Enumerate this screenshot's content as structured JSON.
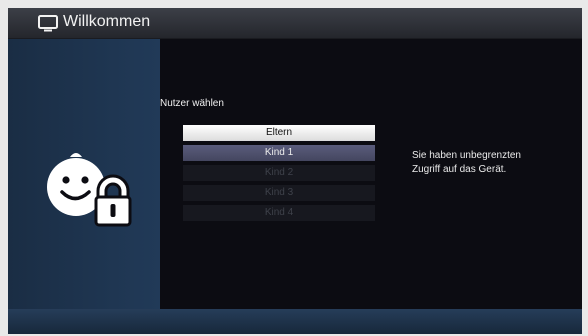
{
  "window": {
    "title": "Willkommen",
    "title_icon": "tv-icon"
  },
  "sidebar": {
    "logo_icon": "child-lock-icon"
  },
  "main": {
    "prompt": "Nutzer wählen",
    "users": [
      {
        "label": "Eltern",
        "state": "selected"
      },
      {
        "label": "Kind 1",
        "state": "active"
      },
      {
        "label": "Kind 2",
        "state": "disabled"
      },
      {
        "label": "Kind 3",
        "state": "disabled"
      },
      {
        "label": "Kind 4",
        "state": "disabled"
      }
    ],
    "info_lines": [
      "Sie haben unbegrenzten",
      "Zugriff auf das Gerät."
    ]
  },
  "colors": {
    "background": "#0c0c12",
    "sidebar": "#213a58",
    "selected_option": "#ffffff",
    "active_option": "#50526e",
    "disabled_option": "#17181f"
  }
}
